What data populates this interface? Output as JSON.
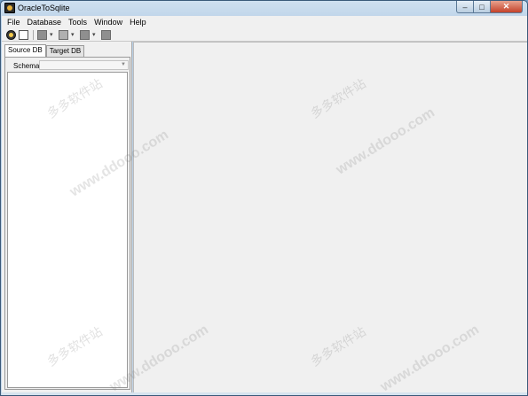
{
  "window": {
    "title": "OracleToSqlite"
  },
  "window_controls": {
    "minimize": "–",
    "maximize": "□",
    "close": "✕"
  },
  "menu": [
    "File",
    "Database",
    "Tools",
    "Window",
    "Help"
  ],
  "toolbar": {
    "icons": [
      "connect-icon",
      "document-icon",
      "database-icon",
      "table-icon",
      "grid-icon",
      "stop-icon"
    ],
    "dropdown_arrow": "▾"
  },
  "left_panel": {
    "tabs": [
      {
        "label": "Source DB",
        "active": true
      },
      {
        "label": "Target DB",
        "active": false
      }
    ],
    "schema": {
      "label": "Schema",
      "value": "",
      "arrow": "▼"
    }
  },
  "watermark": {
    "cn": "多多软件站",
    "url": "www.ddooo.com"
  }
}
